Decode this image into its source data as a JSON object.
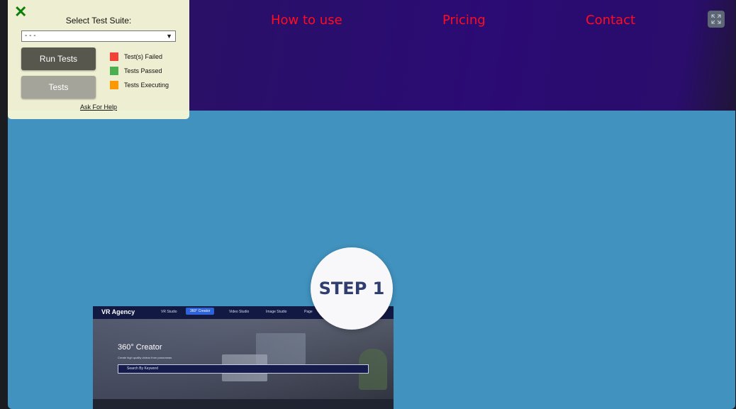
{
  "nav": {
    "links": [
      "How to use",
      "Pricing",
      "Contact"
    ]
  },
  "expand_icon": "expand-icon",
  "test_panel": {
    "close_icon": "close-x-icon",
    "title": "Select Test Suite:",
    "select_value": "- - -",
    "run_button": "Run Tests",
    "tests_button": "Tests",
    "legend": [
      {
        "label": "Test(s) Failed",
        "color": "#f44336"
      },
      {
        "label": "Tests Passed",
        "color": "#4caf50"
      },
      {
        "label": "Tests Executing",
        "color": "#ff9800"
      }
    ],
    "help_link": "Ask For Help"
  },
  "step_badge": "STEP 1",
  "mockup": {
    "logo": "VR Agency",
    "tabs": [
      "VR Studio",
      "360° Creator",
      "Video Studio",
      "Image Studio",
      "Page"
    ],
    "active_tab": 1,
    "heading": "360° Creator",
    "subtitle": "Create high quality videos from panoramas",
    "search_placeholder": "Search By Keyword"
  },
  "colors": {
    "header": "#2b0b74",
    "stage": "#4192bf",
    "nav_link": "#ff0d1f",
    "panel": "#f5f6d6"
  }
}
